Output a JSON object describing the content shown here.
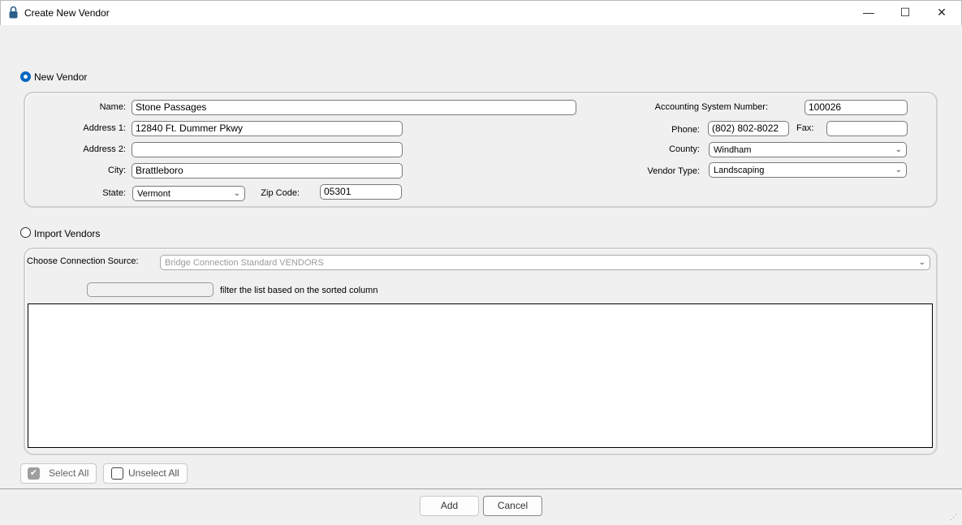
{
  "window": {
    "title": "Create New Vendor",
    "icon": "lock-icon",
    "minimize": "—",
    "maximize": "☐",
    "close": "✕"
  },
  "new_vendor": {
    "label": "New Vendor",
    "selected": true,
    "name_label": "Name:",
    "name": "Stone Passages",
    "address1_label": "Address 1:",
    "address1": "12840 Ft. Dummer Pkwy",
    "address2_label": "Address 2:",
    "address2": "",
    "city_label": "City:",
    "city": "Brattleboro",
    "state_label": "State:",
    "state": "Vermont",
    "zip_label": "Zip Code:",
    "zip": "05301",
    "acct_label": "Accounting System Number:",
    "acct": "100026",
    "phone_label": "Phone:",
    "phone": "(802) 802-8022",
    "fax_label": "Fax:",
    "fax": "",
    "county_label": "County:",
    "county": "Windham",
    "vendor_type_label": "Vendor Type:",
    "vendor_type": "Landscaping"
  },
  "import_vendors": {
    "label": "Import Vendors",
    "selected": false,
    "source_label": "Choose Connection Source:",
    "source": "Bridge Connection Standard VENDORS",
    "filter_value": "",
    "filter_hint": "filter the list based on the sorted column"
  },
  "buttons": {
    "select_all": "Select All",
    "unselect_all": "Unselect All",
    "add": "Add",
    "cancel": "Cancel"
  },
  "colors": {
    "accent": "#0067c0"
  }
}
